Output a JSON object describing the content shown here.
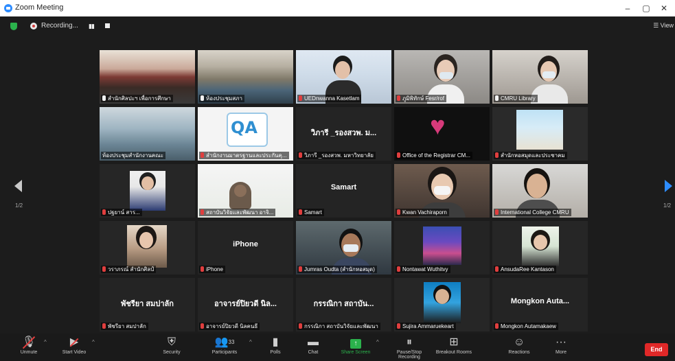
{
  "window": {
    "title": "Zoom Meeting",
    "controls": [
      "–",
      "▢",
      "✕"
    ]
  },
  "topbar": {
    "recording_label": "Recording...",
    "view_label": "View"
  },
  "navigation": {
    "page_left": "1/2",
    "page_right": "1/2"
  },
  "tiles": [
    {
      "name": "สำนักศิลปะฯ เพื่อการศึกษา",
      "mic": "on",
      "display": ""
    },
    {
      "name": "ห้องประชุมสภา",
      "mic": "on",
      "display": "",
      "active": true
    },
    {
      "name": "UEDnwanna Kasetlam",
      "mic": "muted",
      "display": ""
    },
    {
      "name": "ภูมิพิทักษ์ Fesr/rof",
      "mic": "muted",
      "display": ""
    },
    {
      "name": "CMRU Library",
      "mic": "on",
      "display": ""
    },
    {
      "name": "ห้องประชุมสำนักงานคณะ",
      "mic": "none",
      "display": ""
    },
    {
      "name": "สำนักงานมาตรฐานและประกันคุ...",
      "mic": "muted",
      "display": ""
    },
    {
      "name": "วิภารี _รองสวพ. มหาวิทยาลัย",
      "mic": "muted",
      "display": "วิภารี _รองสวพ. ม..."
    },
    {
      "name": "Office of the Registrar CM...",
      "mic": "muted",
      "display": ""
    },
    {
      "name": "สำนักหอสมุดและประชาคม",
      "mic": "muted",
      "display": ""
    },
    {
      "name": "ปฐยาน์ สาร...",
      "mic": "muted",
      "display": ""
    },
    {
      "name": "สถาบันวิจัยและพัฒนา อาจิ...",
      "mic": "muted",
      "display": ""
    },
    {
      "name": "Samart",
      "mic": "muted",
      "display": "Samart"
    },
    {
      "name": "Kwan Vachiraporn",
      "mic": "muted",
      "display": ""
    },
    {
      "name": "International College CMRU",
      "mic": "muted",
      "display": ""
    },
    {
      "name": "วราภรณ์ สำนักศิลป์",
      "mic": "muted",
      "display": ""
    },
    {
      "name": "iPhone",
      "mic": "muted",
      "display": "iPhone"
    },
    {
      "name": "Jumras Oudta (สำนักหอสมุด)",
      "mic": "muted",
      "display": ""
    },
    {
      "name": "Nontawat Wuthitvy",
      "mic": "muted",
      "display": ""
    },
    {
      "name": "AnsudaRee Kantason",
      "mic": "muted",
      "display": ""
    },
    {
      "name": "พัชรียา สมปาลัก",
      "mic": "muted",
      "display": "พัชรียา สมปาลัก"
    },
    {
      "name": "อาจารย์ปิยวดี นิลคนธี",
      "mic": "muted",
      "display": "อาจารย์ปิยวดี นิล..."
    },
    {
      "name": "กรรณิกา สถาบันวิจัยและพัฒนา",
      "mic": "muted",
      "display": "กรรณิกา สถาบัน..."
    },
    {
      "name": "Sujira Ammaruekeart",
      "mic": "muted",
      "display": ""
    },
    {
      "name": "Mongkon Autamakaew",
      "mic": "muted",
      "display": "Mongkon Auta..."
    }
  ],
  "toolbar": {
    "unmute": "Unmute",
    "start_video": "Start Video",
    "security": "Security",
    "participants": "Participants",
    "participants_count": "33",
    "polls": "Polls",
    "chat": "Chat",
    "share_screen": "Share Screen",
    "pause_recording": "Pause/Stop Recording",
    "breakout_rooms": "Breakout Rooms",
    "reactions": "Reactions",
    "more": "More",
    "end": "End"
  },
  "colors": {
    "accent": "#2d8cff",
    "share_green": "#2bb24c",
    "end_red": "#e02828",
    "active_outline": "#c6e234"
  }
}
